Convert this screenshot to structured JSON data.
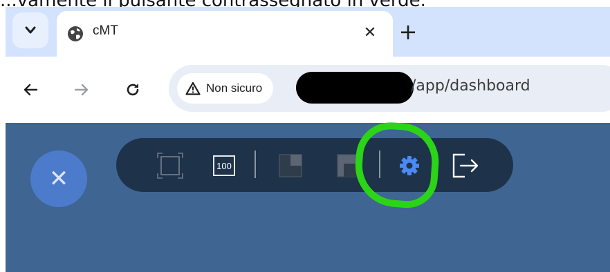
{
  "caption": "...vamente il pulsante contrassegnato in verde.",
  "browser": {
    "tab": {
      "title": "cMT",
      "icon": "globe-icon"
    },
    "tab_menu_icon": "chevron-down-icon",
    "close_tab_symbol": "✕",
    "new_tab_symbol": "+",
    "address_bar": {
      "security_chip": "Non sicuro",
      "url_path": "/app/dashboard"
    }
  },
  "app": {
    "background_color": "#3f6593",
    "close_symbol": "✕",
    "toolbar_buttons": [
      {
        "name": "fullscreen",
        "icon": "fullscreen-icon"
      },
      {
        "name": "zoom",
        "label": "100",
        "icon": "zoom-percent-icon"
      },
      {
        "name": "window-small",
        "icon": "window-small-icon"
      },
      {
        "name": "window-large",
        "icon": "window-large-icon"
      },
      {
        "name": "settings",
        "icon": "gear-icon"
      },
      {
        "name": "logout",
        "icon": "logout-icon"
      }
    ],
    "highlight_color": "#2bd417"
  }
}
